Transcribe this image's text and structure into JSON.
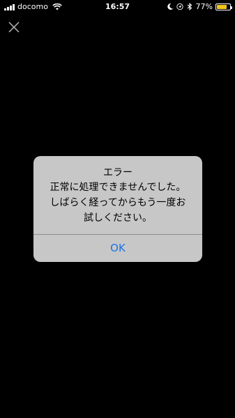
{
  "status_bar": {
    "carrier": "docomo",
    "time": "16:57",
    "battery_percent": "77%",
    "battery_level": 0.77,
    "battery_color": "#f5c518",
    "icons": [
      "signal-icon",
      "wifi-icon",
      "moon-icon",
      "location-icon",
      "bluetooth-icon",
      "battery-icon"
    ]
  },
  "toolbar": {
    "close_icon": "close-icon"
  },
  "alert": {
    "title": "エラー",
    "message_lines": [
      "正常に処理できませんでした。",
      "しばらく経ってからもう一度お",
      "試しください。"
    ],
    "button_label": "OK",
    "button_color": "#1a73e8",
    "background_color": "#c7c7c7"
  }
}
